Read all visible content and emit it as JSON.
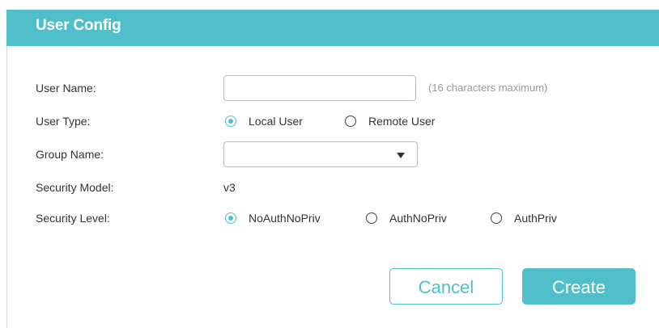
{
  "header": {
    "title": "User Config"
  },
  "form": {
    "user_name": {
      "label": "User Name:",
      "value": "",
      "hint": "(16 characters maximum)"
    },
    "user_type": {
      "label": "User Type:",
      "options": [
        {
          "label": "Local User",
          "checked": true
        },
        {
          "label": "Remote User",
          "checked": false
        }
      ]
    },
    "group_name": {
      "label": "Group Name:",
      "selected": ""
    },
    "security_model": {
      "label": "Security Model:",
      "value": "v3"
    },
    "security_level": {
      "label": "Security Level:",
      "options": [
        {
          "label": "NoAuthNoPriv",
          "checked": true
        },
        {
          "label": "AuthNoPriv",
          "checked": false
        },
        {
          "label": "AuthPriv",
          "checked": false
        }
      ]
    }
  },
  "actions": {
    "cancel_label": "Cancel",
    "create_label": "Create"
  },
  "colors": {
    "accent": "#51bfca",
    "text": "#333333",
    "hint": "#999999"
  }
}
